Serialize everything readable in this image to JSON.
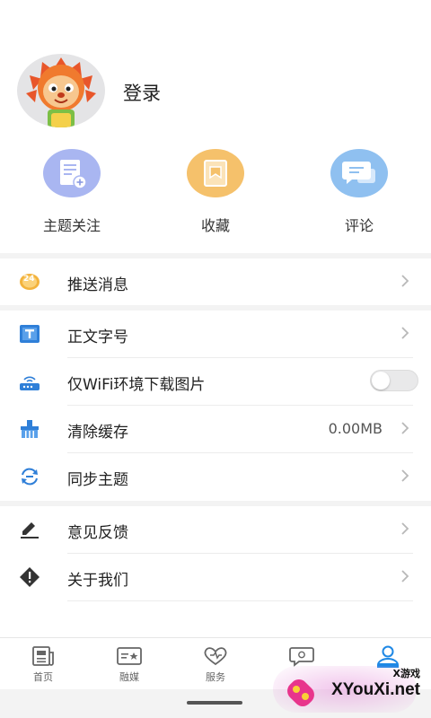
{
  "profile": {
    "login_label": "登录"
  },
  "quick_actions": [
    {
      "label": "主题关注",
      "icon": "topic-follow-icon",
      "color": "#a9b6f1"
    },
    {
      "label": "收藏",
      "icon": "favorite-icon",
      "color": "#f5c16b"
    },
    {
      "label": "评论",
      "icon": "comment-icon",
      "color": "#8fc0f0"
    }
  ],
  "settings": {
    "push": {
      "label": "推送消息",
      "badge": "24"
    },
    "font_size": {
      "label": "正文字号"
    },
    "wifi_only": {
      "label": "仅WiFi环境下载图片",
      "enabled": false
    },
    "clear_cache": {
      "label": "清除缓存",
      "value": "0.00MB"
    },
    "sync_theme": {
      "label": "同步主题"
    },
    "feedback": {
      "label": "意见反馈"
    },
    "about": {
      "label": "关于我们"
    }
  },
  "tabs": [
    {
      "label": "首页",
      "icon": "newspaper-icon"
    },
    {
      "label": "融媒",
      "icon": "media-icon"
    },
    {
      "label": "服务",
      "icon": "heart-icon"
    },
    {
      "label": "",
      "icon": "message-icon"
    },
    {
      "label": "",
      "icon": "user-icon",
      "active": true
    }
  ],
  "watermark": {
    "small": "X游戏",
    "text": "XYouXi.net"
  },
  "colors": {
    "accent": "#1e88e5",
    "arrow": "#b8b8b8",
    "divider": "#ececec"
  }
}
